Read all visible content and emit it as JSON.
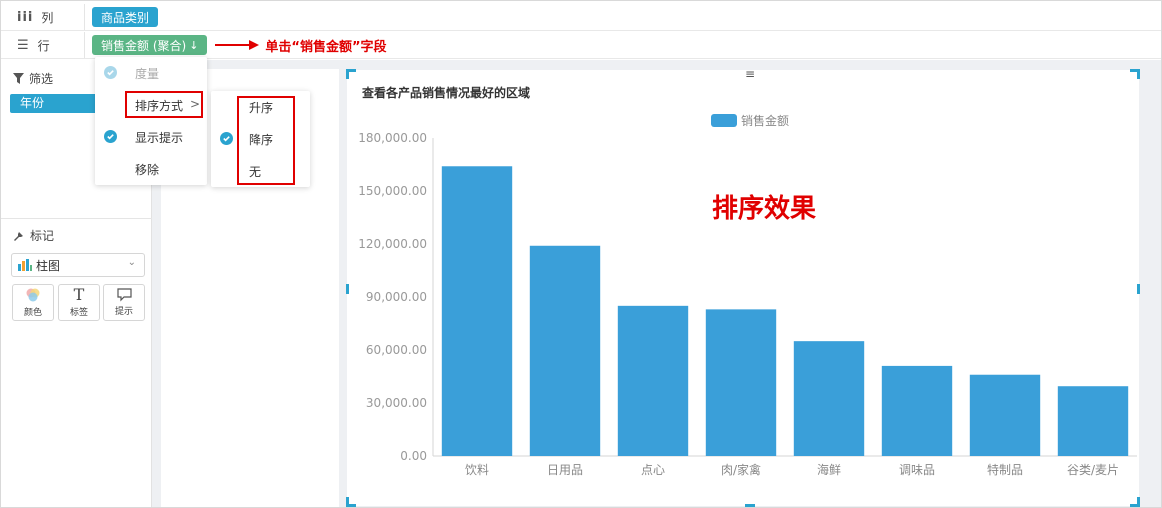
{
  "shelves": {
    "columns": {
      "label": "列",
      "pill": "商品类别"
    },
    "rows": {
      "label": "行",
      "pill": "销售金额 (聚合)",
      "pill_sort_icon": "sort-desc-arrow-icon"
    },
    "annotation": "单击“销售金额”字段"
  },
  "left_panel": {
    "filter_title": "筛选",
    "filter_pill": "年份",
    "marks_title": "标记",
    "mark_type": "柱图",
    "mark_buttons": [
      {
        "label": "颜色",
        "icon": "palette-icon"
      },
      {
        "label": "标签",
        "icon": "text-icon"
      },
      {
        "label": "提示",
        "icon": "tooltip-icon"
      }
    ]
  },
  "context_menu": {
    "items": [
      {
        "label": "度量",
        "checked": true,
        "disabled": true
      },
      {
        "label": "排序方式",
        "has_submenu": true
      },
      {
        "label": "显示提示",
        "checked": true
      },
      {
        "label": "移除"
      }
    ],
    "submenu": [
      {
        "label": "升序"
      },
      {
        "label": "降序",
        "checked": true
      },
      {
        "label": "无"
      }
    ]
  },
  "chart_annotation": "排序效果",
  "colors": {
    "accent": "#2aa3cf",
    "bar": "#3a9fd9",
    "pill_green": "#5bb585",
    "annotation_red": "#e00000"
  },
  "chart_data": {
    "type": "bar",
    "title": "查看各产品销售情况最好的区域",
    "legend": [
      "销售金额"
    ],
    "legend_position": "top-center",
    "categories": [
      "饮料",
      "日用品",
      "点心",
      "肉/家禽",
      "海鲜",
      "调味品",
      "特制品",
      "谷类/麦片"
    ],
    "series": [
      {
        "name": "销售金额",
        "values": [
          164000,
          119000,
          85000,
          83000,
          65000,
          51000,
          46000,
          39500
        ]
      }
    ],
    "y_ticks": [
      "0.00",
      "30,000.00",
      "60,000.00",
      "90,000.00",
      "120,000.00",
      "150,000.00",
      "180,000.00"
    ],
    "ylim": [
      0,
      180000
    ],
    "grid": false
  }
}
